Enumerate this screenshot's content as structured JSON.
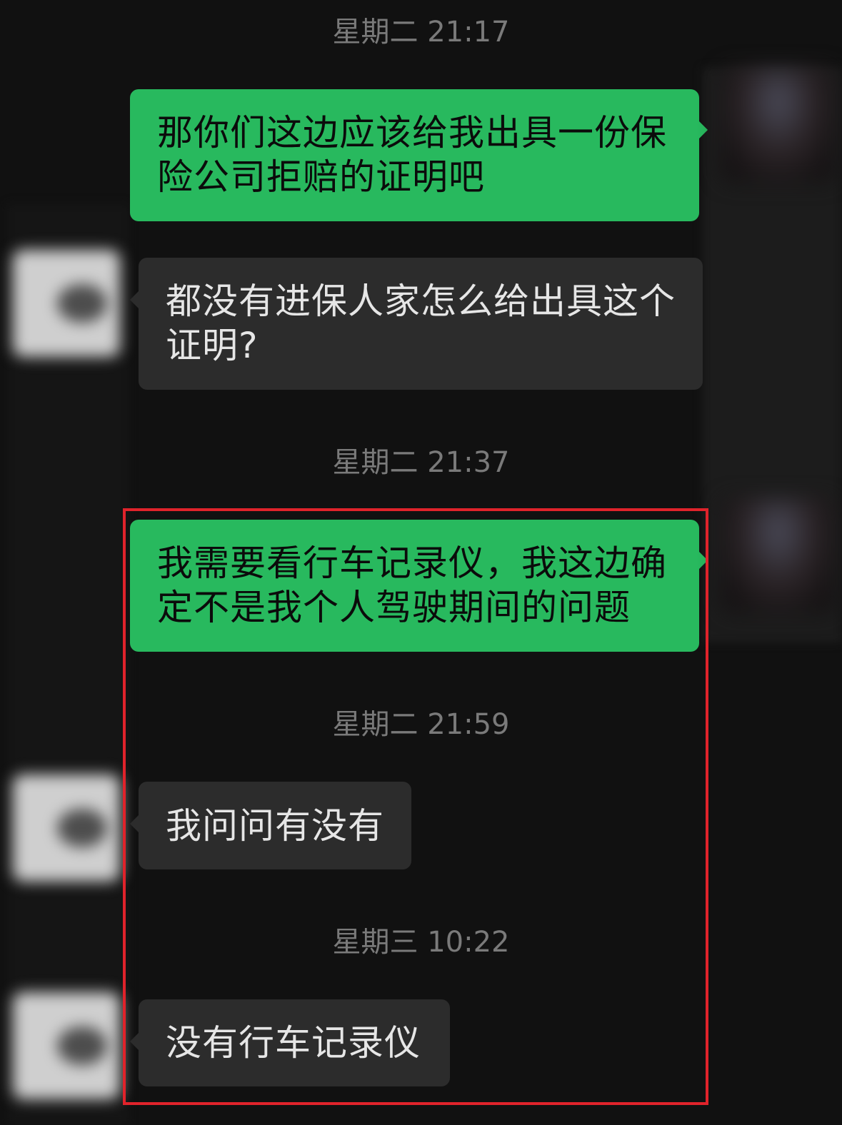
{
  "chat": {
    "timestamps": [
      "星期二 21:17",
      "星期二 21:37",
      "星期二 21:59",
      "星期三 10:22"
    ],
    "messages": [
      {
        "sender": "me",
        "text": "那你们这边应该给我出具一份保\n险公司拒赔的证明吧"
      },
      {
        "sender": "other",
        "text": "都没有进保人家怎么给出具这个\n证明?"
      },
      {
        "sender": "me",
        "text": "我需要看行车记录仪，我这边确\n定不是我个人驾驶期间的问题"
      },
      {
        "sender": "other",
        "text": "我问问有没有"
      },
      {
        "sender": "other",
        "text": "没有行车记录仪"
      }
    ]
  },
  "colors": {
    "background": "#111111",
    "outgoing_bubble": "#28b95e",
    "incoming_bubble": "#2c2c2c",
    "timestamp_text": "#7a7a7a",
    "highlight_border": "#e0232b"
  },
  "icons": {
    "my_avatar": "blurred-avatar-icon",
    "contact_avatar": "blurred-avatar-icon"
  }
}
